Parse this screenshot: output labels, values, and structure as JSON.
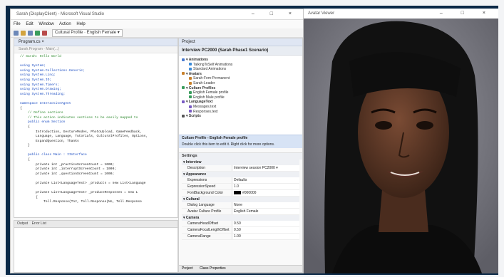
{
  "ide": {
    "title": "Sarah (DisplayClient) - Microsoft Visual Studio",
    "window_controls": "– □ ×",
    "menu": [
      "File",
      "Edit",
      "Window",
      "Action",
      "Help"
    ],
    "toolbar_combo": "Cultural Profile · English Female ▾",
    "editor_tab": "Program.cs ×",
    "editor_nav": "Sarah.Program  ·  Main(...)",
    "code": [
      {
        "cls": "cm",
        "t": "// Sarah: Hello World"
      },
      {
        "cls": "",
        "t": ""
      },
      {
        "cls": "kw",
        "t": "using System;"
      },
      {
        "cls": "kw",
        "t": "using System.Collections.Generic;"
      },
      {
        "cls": "kw",
        "t": "using System.Linq;"
      },
      {
        "cls": "kw",
        "t": "using System.IO;"
      },
      {
        "cls": "kw",
        "t": "using System.Timers;"
      },
      {
        "cls": "kw",
        "t": "using System.Drawing;"
      },
      {
        "cls": "kw",
        "t": "using System.Threading;"
      },
      {
        "cls": "",
        "t": ""
      },
      {
        "cls": "kw",
        "t": "namespace InteractiveAgent"
      },
      {
        "cls": "",
        "t": "{"
      },
      {
        "cls": "cm",
        "t": "    // Define sections"
      },
      {
        "cls": "cm",
        "t": "    // This action indicates sections to be easily mapped to"
      },
      {
        "cls": "kw",
        "t": "    public enum Section"
      },
      {
        "cls": "",
        "t": "    {"
      },
      {
        "cls": "",
        "t": "        Introduction, GestureModes, PhotoUpload, GameFeedback,"
      },
      {
        "cls": "",
        "t": "        Language, Language, Tutorials, CulturalProfiles, Options,"
      },
      {
        "cls": "",
        "t": "        ExpandQuestion, Thanks"
      },
      {
        "cls": "",
        "t": "    }"
      },
      {
        "cls": "",
        "t": ""
      },
      {
        "cls": "kw",
        "t": "    public class Main : IInterface"
      },
      {
        "cls": "",
        "t": "    {"
      },
      {
        "cls": "",
        "t": "        private int _practiceScreenCount = 1000;"
      },
      {
        "cls": "",
        "t": "        private int _interruptScreenCount = 1000;"
      },
      {
        "cls": "",
        "t": "        private int _questionScreenCount = 1000;"
      },
      {
        "cls": "",
        "t": ""
      },
      {
        "cls": "",
        "t": "        private List<LanguageText> _products = new List<Language"
      },
      {
        "cls": "",
        "t": ""
      },
      {
        "cls": "",
        "t": "        private List<LanguageText> _productResponses = new L"
      },
      {
        "cls": "",
        "t": "        {"
      },
      {
        "cls": "",
        "t": "            Tell.Response(Tnz, Tell.Response(No, Tell.Response"
      }
    ],
    "output_tabs": "Output",
    "output_tabs2": "Error List",
    "panel_header": "Project",
    "project_title": "Interview PC2000 (Sarah Phase1 Scenario)",
    "tree": [
      {
        "type": "g",
        "label": "Animations",
        "color": "#4a7bd0"
      },
      {
        "type": "i",
        "label": "TalkingToSelf Animations",
        "color": "#3d8bd6"
      },
      {
        "type": "i",
        "label": "Standard Animations",
        "color": "#3d8bd6"
      },
      {
        "type": "g",
        "label": "Avatars",
        "color": "#c9812b"
      },
      {
        "type": "i",
        "label": "Sarah-Fem-Permanent",
        "color": "#c9812b"
      },
      {
        "type": "i",
        "label": "Sarah-Leader",
        "color": "#c9812b"
      },
      {
        "type": "g",
        "label": "Culture Profiles",
        "color": "#3a9d5d"
      },
      {
        "type": "i",
        "label": "English Female profile",
        "color": "#3a9d5d"
      },
      {
        "type": "i",
        "label": "English Male profile",
        "color": "#3a9d5d"
      },
      {
        "type": "g",
        "label": "LanguageText",
        "color": "#7a5cc4"
      },
      {
        "type": "i",
        "label": "Messages.text",
        "color": "#7a5cc4"
      },
      {
        "type": "i",
        "label": "Responses.text",
        "color": "#7a5cc4"
      },
      {
        "type": "g",
        "label": "Scripts",
        "color": "#555555"
      }
    ],
    "selection_title": "Culture Profile - English Female profile",
    "selection_desc": "Double click this item to edit it. Right click for more options.",
    "settings_header": "Settings",
    "settings": [
      {
        "section": "Interview",
        "rows": [
          {
            "k": "Description",
            "v": "Interview session PC2000 ▾"
          }
        ]
      },
      {
        "section": "Appearance",
        "rows": [
          {
            "k": "Expressions",
            "v": "Defaults"
          },
          {
            "k": "ExpressionSpeed",
            "v": "1.0"
          },
          {
            "k": "FontBackground Color",
            "v": "#000000"
          }
        ]
      },
      {
        "section": "Cultural",
        "rows": [
          {
            "k": "Dialog Language",
            "v": "None"
          },
          {
            "k": "Avatar Culture Profile",
            "v": "English Female"
          }
        ]
      },
      {
        "section": "Camera",
        "rows": [
          {
            "k": "CameraHeadOffset",
            "v": "0.50"
          },
          {
            "k": "CameraFocalLengthOffset",
            "v": "0.50"
          },
          {
            "k": "CameraRange",
            "v": "1.00"
          }
        ]
      }
    ],
    "panel_bottom_tabs": [
      "Project",
      "Class Properties"
    ]
  },
  "viewer": {
    "title": "Avatar Viewer",
    "window_controls": "– □ ×"
  }
}
